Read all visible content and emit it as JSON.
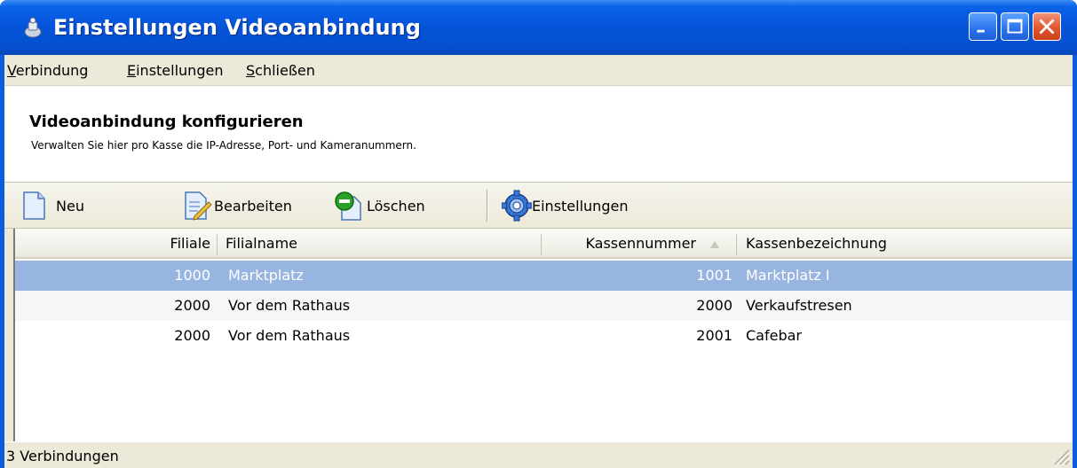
{
  "window": {
    "title": "Einstellungen Videoanbindung",
    "title_icon": "app-icon"
  },
  "titlebar_buttons": {
    "minimize": "minimize-icon",
    "maximize": "maximize-icon",
    "close": "close-icon"
  },
  "menu": {
    "items": [
      {
        "mnemonic": "V",
        "rest": "erbindung"
      },
      {
        "mnemonic": "E",
        "rest": "instellungen"
      },
      {
        "mnemonic": "S",
        "rest": "chließen"
      }
    ]
  },
  "header": {
    "title": "Videoanbindung konfigurieren",
    "subtitle": "Verwalten Sie hier pro Kasse die IP-Adresse, Port- und Kameranummern."
  },
  "toolbar": {
    "new_label": "Neu",
    "edit_label": "Bearbeiten",
    "delete_label": "Löschen",
    "settings_label": "Einstellungen"
  },
  "table": {
    "columns": [
      "Filiale",
      "Filialname",
      "Kassennummer",
      "Kassenbezeichnung"
    ],
    "sort_column": "Kassennummer",
    "sort_direction": "ascending",
    "rows": [
      {
        "filiale": "1000",
        "filialname": "Marktplatz",
        "kassennummer": "1001",
        "kassenbezeichnung": "Marktplatz I",
        "selected": true
      },
      {
        "filiale": "2000",
        "filialname": "Vor dem Rathaus",
        "kassennummer": "2000",
        "kassenbezeichnung": "Verkaufstresen",
        "selected": false
      },
      {
        "filiale": "2000",
        "filialname": "Vor dem Rathaus",
        "kassennummer": "2001",
        "kassenbezeichnung": "Cafebar",
        "selected": false
      }
    ]
  },
  "status": {
    "text": "3 Verbindungen"
  },
  "colors": {
    "titlebar": "#0553d8",
    "selection": "#98b4e0",
    "close_button": "#e2562f"
  }
}
